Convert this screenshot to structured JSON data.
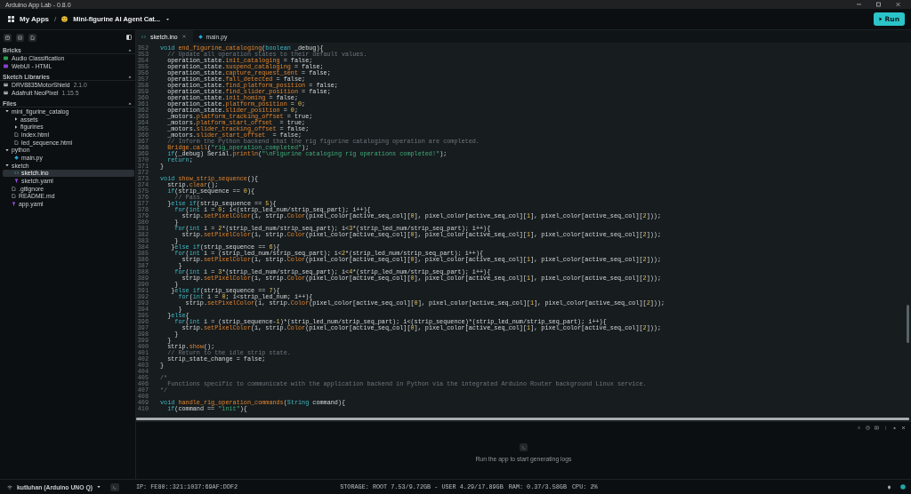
{
  "window": {
    "title": "Arduino App Lab - 0.8.0"
  },
  "header": {
    "home": "My Apps",
    "separator": "/",
    "app_title": "Mini-figurine AI Agent Cat...",
    "run_button": "Run"
  },
  "sidebar": {
    "bricks": {
      "heading": "Bricks",
      "items": [
        {
          "name": "Audio Classification",
          "color": "#2e9e4f"
        },
        {
          "name": "WebUI - HTML",
          "color": "#8a3fd1"
        }
      ]
    },
    "libraries": {
      "heading": "Sketch Libraries",
      "items": [
        {
          "name": "DRV8835MotorShield",
          "version": "2.1.0"
        },
        {
          "name": "Adafruit NeoPixel",
          "version": "1.15.5"
        }
      ]
    },
    "files": {
      "heading": "Files",
      "tree": [
        {
          "name": "mini_figurine_catalog",
          "kind": "folder",
          "expanded": true,
          "selected": false,
          "children": [
            {
              "name": "assets",
              "kind": "folder",
              "expanded": false,
              "selected": false
            },
            {
              "name": "figurines",
              "kind": "folder",
              "expanded": false,
              "selected": false
            },
            {
              "name": "index.html",
              "kind": "file",
              "selected": false
            },
            {
              "name": "led_sequence.html",
              "kind": "file",
              "selected": false
            }
          ]
        },
        {
          "name": "python",
          "kind": "folder",
          "expanded": true,
          "selected": false,
          "children": [
            {
              "name": "main.py",
              "kind": "python",
              "selected": false
            }
          ]
        },
        {
          "name": "sketch",
          "kind": "folder",
          "expanded": true,
          "selected": false,
          "children": [
            {
              "name": "sketch.ino",
              "kind": "ino",
              "selected": true
            },
            {
              "name": "sketch.yaml",
              "kind": "yaml",
              "selected": false
            }
          ]
        },
        {
          "name": ".gitignore",
          "kind": "file",
          "selected": false
        },
        {
          "name": "README.md",
          "kind": "file",
          "selected": false
        },
        {
          "name": "app.yaml",
          "kind": "yaml",
          "selected": false
        }
      ]
    }
  },
  "editor": {
    "tabs": [
      {
        "label": "sketch.ino",
        "kind": "ino",
        "selected": true
      },
      {
        "label": "main.py",
        "kind": "python",
        "selected": false
      }
    ],
    "lines": [
      {
        "n": "352",
        "t": [
          {
            "kind": "keyword",
            "text": "void "
          },
          {
            "kind": "member",
            "text": "end_figurine_cataloging"
          },
          {
            "kind": "plain",
            "text": "("
          },
          {
            "kind": "keyword",
            "text": "boolean"
          },
          {
            "kind": "plain",
            "text": " _debug){"
          }
        ]
      },
      {
        "n": "353",
        "t": [
          {
            "kind": "comment",
            "text": "  // Update all operation states to their default values."
          }
        ]
      },
      {
        "n": "354",
        "t": [
          {
            "kind": "plain",
            "text": "  operation_state."
          },
          {
            "kind": "member",
            "text": "init_cataloging"
          },
          {
            "kind": "plain",
            "text": " = false;"
          }
        ]
      },
      {
        "n": "355",
        "t": [
          {
            "kind": "plain",
            "text": "  operation_state."
          },
          {
            "kind": "member",
            "text": "suspend_cataloging"
          },
          {
            "kind": "plain",
            "text": " = false;"
          }
        ]
      },
      {
        "n": "356",
        "t": [
          {
            "kind": "plain",
            "text": "  operation_state."
          },
          {
            "kind": "member",
            "text": "capture_request_sent"
          },
          {
            "kind": "plain",
            "text": " = false;"
          }
        ]
      },
      {
        "n": "357",
        "t": [
          {
            "kind": "plain",
            "text": "  operation_state."
          },
          {
            "kind": "member",
            "text": "fall_detected"
          },
          {
            "kind": "plain",
            "text": " = false;"
          }
        ]
      },
      {
        "n": "358",
        "t": [
          {
            "kind": "plain",
            "text": "  operation_state."
          },
          {
            "kind": "member",
            "text": "find_platform_position"
          },
          {
            "kind": "plain",
            "text": " = false;"
          }
        ]
      },
      {
        "n": "359",
        "t": [
          {
            "kind": "plain",
            "text": "  operation_state."
          },
          {
            "kind": "member",
            "text": "find_slider_position"
          },
          {
            "kind": "plain",
            "text": " = false;"
          }
        ]
      },
      {
        "n": "360",
        "t": [
          {
            "kind": "plain",
            "text": "  operation_state."
          },
          {
            "kind": "member",
            "text": "init_homing"
          },
          {
            "kind": "plain",
            "text": " = false;"
          }
        ]
      },
      {
        "n": "361",
        "t": [
          {
            "kind": "plain",
            "text": "  operation_state."
          },
          {
            "kind": "member",
            "text": "platform_position"
          },
          {
            "kind": "plain",
            "text": " = "
          },
          {
            "kind": "number",
            "text": "0"
          },
          {
            "kind": "plain",
            "text": ";"
          }
        ]
      },
      {
        "n": "362",
        "t": [
          {
            "kind": "plain",
            "text": "  operation_state."
          },
          {
            "kind": "member",
            "text": "slider_position"
          },
          {
            "kind": "plain",
            "text": " = "
          },
          {
            "kind": "number",
            "text": "0"
          },
          {
            "kind": "plain",
            "text": ";"
          }
        ]
      },
      {
        "n": "363",
        "t": [
          {
            "kind": "plain",
            "text": "  _motors."
          },
          {
            "kind": "member",
            "text": "platform_tracking_offset"
          },
          {
            "kind": "plain",
            "text": " = true;"
          }
        ]
      },
      {
        "n": "364",
        "t": [
          {
            "kind": "plain",
            "text": "  _motors."
          },
          {
            "kind": "member",
            "text": "platform_start_offset"
          },
          {
            "kind": "plain",
            "text": "  = true;"
          }
        ]
      },
      {
        "n": "365",
        "t": [
          {
            "kind": "plain",
            "text": "  _motors."
          },
          {
            "kind": "member",
            "text": "slider_tracking_offset"
          },
          {
            "kind": "plain",
            "text": " = false;"
          }
        ]
      },
      {
        "n": "366",
        "t": [
          {
            "kind": "plain",
            "text": "  _motors."
          },
          {
            "kind": "member",
            "text": "slider_start_offset"
          },
          {
            "kind": "plain",
            "text": "  = false;"
          }
        ]
      },
      {
        "n": "367",
        "t": [
          {
            "kind": "comment",
            "text": "  // Inform the Python backend that the rig figurine cataloging operation are completed."
          }
        ]
      },
      {
        "n": "368",
        "t": [
          {
            "kind": "member",
            "text": "  Bridge.call"
          },
          {
            "kind": "plain",
            "text": "("
          },
          {
            "kind": "string",
            "text": "\"rig_operation_completed\""
          },
          {
            "kind": "plain",
            "text": ");"
          }
        ]
      },
      {
        "n": "369",
        "t": [
          {
            "kind": "keyword",
            "text": "  if"
          },
          {
            "kind": "plain",
            "text": "(_debug) Serial."
          },
          {
            "kind": "member",
            "text": "println"
          },
          {
            "kind": "plain",
            "text": "("
          },
          {
            "kind": "string",
            "text": "\"\\nFigurine cataloging rig operations completed!\""
          },
          {
            "kind": "plain",
            "text": ");"
          }
        ]
      },
      {
        "n": "370",
        "t": [
          {
            "kind": "keyword",
            "text": "  return"
          },
          {
            "kind": "plain",
            "text": ";"
          }
        ]
      },
      {
        "n": "371",
        "t": [
          {
            "kind": "plain",
            "text": "}"
          }
        ]
      },
      {
        "n": "372"
      },
      {
        "n": "373",
        "t": [
          {
            "kind": "keyword",
            "text": "void "
          },
          {
            "kind": "member",
            "text": "show_strip_sequence"
          },
          {
            "kind": "plain",
            "text": "(){"
          }
        ]
      },
      {
        "n": "374",
        "t": [
          {
            "kind": "plain",
            "text": "  strip."
          },
          {
            "kind": "member",
            "text": "clear"
          },
          {
            "kind": "plain",
            "text": "();"
          }
        ]
      },
      {
        "n": "375",
        "t": [
          {
            "kind": "keyword",
            "text": "  if"
          },
          {
            "kind": "plain",
            "text": "(strip_sequence == "
          },
          {
            "kind": "number",
            "text": "0"
          },
          {
            "kind": "plain",
            "text": "){"
          }
        ]
      },
      {
        "n": "376",
        "t": [
          {
            "kind": "comment",
            "text": "    // Pass."
          }
        ]
      },
      {
        "n": "377",
        "t": [
          {
            "kind": "plain",
            "text": "  }"
          },
          {
            "kind": "keyword",
            "text": "else if"
          },
          {
            "kind": "plain",
            "text": "(strip_sequence == "
          },
          {
            "kind": "number",
            "text": "5"
          },
          {
            "kind": "plain",
            "text": "){"
          }
        ]
      },
      {
        "n": "378",
        "t": [
          {
            "kind": "keyword",
            "text": "    for"
          },
          {
            "kind": "plain",
            "text": "("
          },
          {
            "kind": "keyword",
            "text": "int"
          },
          {
            "kind": "plain",
            "text": " i = "
          },
          {
            "kind": "number",
            "text": "0"
          },
          {
            "kind": "plain",
            "text": "; i<(strip_led_num/strip_seq_part); i++){"
          }
        ]
      },
      {
        "n": "379",
        "t": [
          {
            "kind": "plain",
            "text": "      strip."
          },
          {
            "kind": "member",
            "text": "setPixelColor"
          },
          {
            "kind": "plain",
            "text": "(i, strip."
          },
          {
            "kind": "member",
            "text": "Color"
          },
          {
            "kind": "plain",
            "text": "(pixel_color[active_seq_col]["
          },
          {
            "kind": "number",
            "text": "0"
          },
          {
            "kind": "plain",
            "text": "], pixel_color[active_seq_col]["
          },
          {
            "kind": "number",
            "text": "1"
          },
          {
            "kind": "plain",
            "text": "], pixel_color[active_seq_col]["
          },
          {
            "kind": "number",
            "text": "2"
          },
          {
            "kind": "plain",
            "text": "]));"
          }
        ]
      },
      {
        "n": "380",
        "t": [
          {
            "kind": "plain",
            "text": "    }"
          }
        ]
      },
      {
        "n": "381",
        "t": [
          {
            "kind": "keyword",
            "text": "    for"
          },
          {
            "kind": "plain",
            "text": "("
          },
          {
            "kind": "keyword",
            "text": "int"
          },
          {
            "kind": "plain",
            "text": " i = "
          },
          {
            "kind": "number",
            "text": "2"
          },
          {
            "kind": "plain",
            "text": "*(strip_led_num/strip_seq_part); i<"
          },
          {
            "kind": "number",
            "text": "3"
          },
          {
            "kind": "plain",
            "text": "*(strip_led_num/strip_seq_part); i++){"
          }
        ]
      },
      {
        "n": "382",
        "t": [
          {
            "kind": "plain",
            "text": "      strip."
          },
          {
            "kind": "member",
            "text": "setPixelColor"
          },
          {
            "kind": "plain",
            "text": "(i, strip."
          },
          {
            "kind": "member",
            "text": "Color"
          },
          {
            "kind": "plain",
            "text": "(pixel_color[active_seq_col]["
          },
          {
            "kind": "number",
            "text": "0"
          },
          {
            "kind": "plain",
            "text": "], pixel_color[active_seq_col]["
          },
          {
            "kind": "number",
            "text": "1"
          },
          {
            "kind": "plain",
            "text": "], pixel_color[active_seq_col]["
          },
          {
            "kind": "number",
            "text": "2"
          },
          {
            "kind": "plain",
            "text": "]));"
          }
        ]
      },
      {
        "n": "383",
        "t": [
          {
            "kind": "plain",
            "text": "    }"
          }
        ]
      },
      {
        "n": "384",
        "t": [
          {
            "kind": "plain",
            "text": "   }"
          },
          {
            "kind": "keyword",
            "text": "else if"
          },
          {
            "kind": "plain",
            "text": "(strip_sequence == "
          },
          {
            "kind": "number",
            "text": "6"
          },
          {
            "kind": "plain",
            "text": "){"
          }
        ]
      },
      {
        "n": "385",
        "t": [
          {
            "kind": "keyword",
            "text": "    for"
          },
          {
            "kind": "plain",
            "text": "("
          },
          {
            "kind": "keyword",
            "text": "int"
          },
          {
            "kind": "plain",
            "text": " i = (strip_led_num/strip_seq_part); i<"
          },
          {
            "kind": "number",
            "text": "2"
          },
          {
            "kind": "plain",
            "text": "*(strip_led_num/strip_seq_part); i++){"
          }
        ]
      },
      {
        "n": "386",
        "t": [
          {
            "kind": "plain",
            "text": "      strip."
          },
          {
            "kind": "member",
            "text": "setPixelColor"
          },
          {
            "kind": "plain",
            "text": "(i, strip."
          },
          {
            "kind": "member",
            "text": "Color"
          },
          {
            "kind": "plain",
            "text": "(pixel_color[active_seq_col]["
          },
          {
            "kind": "number",
            "text": "0"
          },
          {
            "kind": "plain",
            "text": "], pixel_color[active_seq_col]["
          },
          {
            "kind": "number",
            "text": "1"
          },
          {
            "kind": "plain",
            "text": "], pixel_color[active_seq_col]["
          },
          {
            "kind": "number",
            "text": "2"
          },
          {
            "kind": "plain",
            "text": "]));"
          }
        ]
      },
      {
        "n": "387",
        "t": [
          {
            "kind": "plain",
            "text": "     }"
          }
        ]
      },
      {
        "n": "388",
        "t": [
          {
            "kind": "keyword",
            "text": "    for"
          },
          {
            "kind": "plain",
            "text": "("
          },
          {
            "kind": "keyword",
            "text": "int"
          },
          {
            "kind": "plain",
            "text": " i = "
          },
          {
            "kind": "number",
            "text": "3"
          },
          {
            "kind": "plain",
            "text": "*(strip_led_num/strip_seq_part); i<"
          },
          {
            "kind": "number",
            "text": "4"
          },
          {
            "kind": "plain",
            "text": "*(strip_led_num/strip_seq_part); i++){"
          }
        ]
      },
      {
        "n": "389",
        "t": [
          {
            "kind": "plain",
            "text": "      strip."
          },
          {
            "kind": "member",
            "text": "setPixelColor"
          },
          {
            "kind": "plain",
            "text": "(i, strip."
          },
          {
            "kind": "member",
            "text": "Color"
          },
          {
            "kind": "plain",
            "text": "(pixel_color[active_seq_col]["
          },
          {
            "kind": "number",
            "text": "0"
          },
          {
            "kind": "plain",
            "text": "], pixel_color[active_seq_col]["
          },
          {
            "kind": "number",
            "text": "1"
          },
          {
            "kind": "plain",
            "text": "], pixel_color[active_seq_col]["
          },
          {
            "kind": "number",
            "text": "2"
          },
          {
            "kind": "plain",
            "text": "]));"
          }
        ]
      },
      {
        "n": "390",
        "t": [
          {
            "kind": "plain",
            "text": "    }"
          }
        ]
      },
      {
        "n": "391",
        "t": [
          {
            "kind": "plain",
            "text": "   }"
          },
          {
            "kind": "keyword",
            "text": "else if"
          },
          {
            "kind": "plain",
            "text": "(strip_sequence == "
          },
          {
            "kind": "number",
            "text": "7"
          },
          {
            "kind": "plain",
            "text": "){"
          }
        ]
      },
      {
        "n": "392",
        "t": [
          {
            "kind": "keyword",
            "text": "     for"
          },
          {
            "kind": "plain",
            "text": "("
          },
          {
            "kind": "keyword",
            "text": "int"
          },
          {
            "kind": "plain",
            "text": " i = "
          },
          {
            "kind": "number",
            "text": "0"
          },
          {
            "kind": "plain",
            "text": "; i<strip_led_num; i++){"
          }
        ]
      },
      {
        "n": "393",
        "t": [
          {
            "kind": "plain",
            "text": "       strip."
          },
          {
            "kind": "member",
            "text": "setPixelColor"
          },
          {
            "kind": "plain",
            "text": "(i, strip."
          },
          {
            "kind": "member",
            "text": "Color"
          },
          {
            "kind": "plain",
            "text": "(pixel_color[active_seq_col]["
          },
          {
            "kind": "number",
            "text": "0"
          },
          {
            "kind": "plain",
            "text": "], pixel_color[active_seq_col]["
          },
          {
            "kind": "number",
            "text": "1"
          },
          {
            "kind": "plain",
            "text": "], pixel_color[active_seq_col]["
          },
          {
            "kind": "number",
            "text": "2"
          },
          {
            "kind": "plain",
            "text": "]));"
          }
        ]
      },
      {
        "n": "394",
        "t": [
          {
            "kind": "plain",
            "text": "     }"
          }
        ]
      },
      {
        "n": "395",
        "t": [
          {
            "kind": "plain",
            "text": "  }"
          },
          {
            "kind": "keyword",
            "text": "else"
          },
          {
            "kind": "plain",
            "text": "{"
          }
        ]
      },
      {
        "n": "396",
        "t": [
          {
            "kind": "keyword",
            "text": "    for"
          },
          {
            "kind": "plain",
            "text": "("
          },
          {
            "kind": "keyword",
            "text": "int"
          },
          {
            "kind": "plain",
            "text": " i = (strip_sequence-"
          },
          {
            "kind": "number",
            "text": "1"
          },
          {
            "kind": "plain",
            "text": ")*(strip_led_num/strip_seq_part); i<(strip_sequence)*(strip_led_num/strip_seq_part); i++){"
          }
        ]
      },
      {
        "n": "397",
        "t": [
          {
            "kind": "plain",
            "text": "      strip."
          },
          {
            "kind": "member",
            "text": "setPixelColor"
          },
          {
            "kind": "plain",
            "text": "(i, strip."
          },
          {
            "kind": "member",
            "text": "Color"
          },
          {
            "kind": "plain",
            "text": "(pixel_color[active_seq_col]["
          },
          {
            "kind": "number",
            "text": "0"
          },
          {
            "kind": "plain",
            "text": "], pixel_color[active_seq_col]["
          },
          {
            "kind": "number",
            "text": "1"
          },
          {
            "kind": "plain",
            "text": "], pixel_color[active_seq_col]["
          },
          {
            "kind": "number",
            "text": "2"
          },
          {
            "kind": "plain",
            "text": "]));"
          }
        ]
      },
      {
        "n": "398",
        "t": [
          {
            "kind": "plain",
            "text": "    }"
          }
        ]
      },
      {
        "n": "399",
        "t": [
          {
            "kind": "plain",
            "text": "  }"
          }
        ]
      },
      {
        "n": "400",
        "t": [
          {
            "kind": "plain",
            "text": "  strip."
          },
          {
            "kind": "member",
            "text": "show"
          },
          {
            "kind": "plain",
            "text": "();"
          }
        ]
      },
      {
        "n": "401",
        "t": [
          {
            "kind": "comment",
            "text": "  // Return to the idle strip state."
          }
        ]
      },
      {
        "n": "402",
        "t": [
          {
            "kind": "plain",
            "text": "  strip_state_change = false;"
          }
        ]
      },
      {
        "n": "403",
        "t": [
          {
            "kind": "plain",
            "text": "}"
          }
        ]
      },
      {
        "n": "404"
      },
      {
        "n": "405",
        "t": [
          {
            "kind": "comment",
            "text": "/*"
          }
        ]
      },
      {
        "n": "406",
        "t": [
          {
            "kind": "comment",
            "text": "  Functions specific to communicate with the application backend in Python via the integrated Arduino Router background Linux service."
          }
        ]
      },
      {
        "n": "407",
        "t": [
          {
            "kind": "comment",
            "text": "*/"
          }
        ]
      },
      {
        "n": "408"
      },
      {
        "n": "409",
        "t": [
          {
            "kind": "keyword",
            "text": "void "
          },
          {
            "kind": "member",
            "text": "handle_rig_operation_commands"
          },
          {
            "kind": "plain",
            "text": "("
          },
          {
            "kind": "keyword",
            "text": "String"
          },
          {
            "kind": "plain",
            "text": " command){"
          }
        ]
      },
      {
        "n": "410",
        "t": [
          {
            "kind": "keyword",
            "text": "  if"
          },
          {
            "kind": "plain",
            "text": "(command == "
          },
          {
            "kind": "string",
            "text": "\"init\""
          },
          {
            "kind": "plain",
            "text": "){"
          }
        ]
      }
    ]
  },
  "output_panel": {
    "message": "Run the app to start generating logs"
  },
  "status_bar": {
    "device": "kutluhan (Arduino UNO Q)",
    "ip": "IP: FE80::321:1037:69AF:DDF2",
    "storage": "STORAGE: ROOT 7.53/9.72GB - USER 4.29/17.89GB",
    "ram": "RAM: 0.37/3.58GB",
    "cpu": "CPU: 2%"
  }
}
